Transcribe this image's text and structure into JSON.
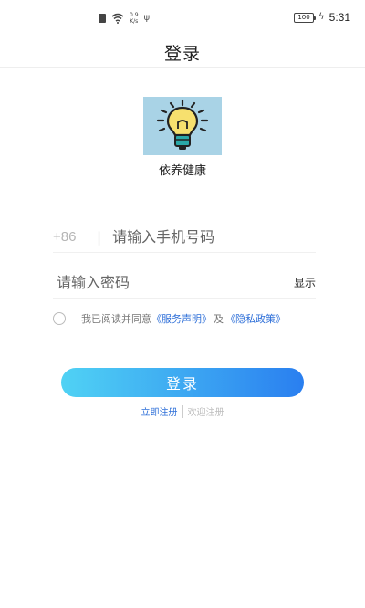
{
  "status_bar": {
    "net_speed_value": "0.9",
    "net_speed_unit": "K/s",
    "battery": "100",
    "time": "5:31"
  },
  "header": {
    "title": "登录"
  },
  "app": {
    "name": "依养健康"
  },
  "form": {
    "country_code": "+86",
    "code_separator": "|",
    "phone_placeholder": "请输入手机号码",
    "password_placeholder": "请输入密码",
    "show_password_label": "显示"
  },
  "agreement": {
    "prefix": "我已阅读并同意",
    "service_link": "《服务声明》",
    "and": "及",
    "privacy_link": "《隐私政策》"
  },
  "actions": {
    "login_label": "登录",
    "register_label": "立即注册",
    "welcome_label": "欢迎注册"
  },
  "colors": {
    "accent_link": "#2e6fd8",
    "button_gradient_start": "#50d2f4",
    "button_gradient_end": "#2a7ff0",
    "logo_background": "#a9d3e6",
    "bulb_yellow": "#f7e06e",
    "bulb_base": "#2aa8a8"
  }
}
